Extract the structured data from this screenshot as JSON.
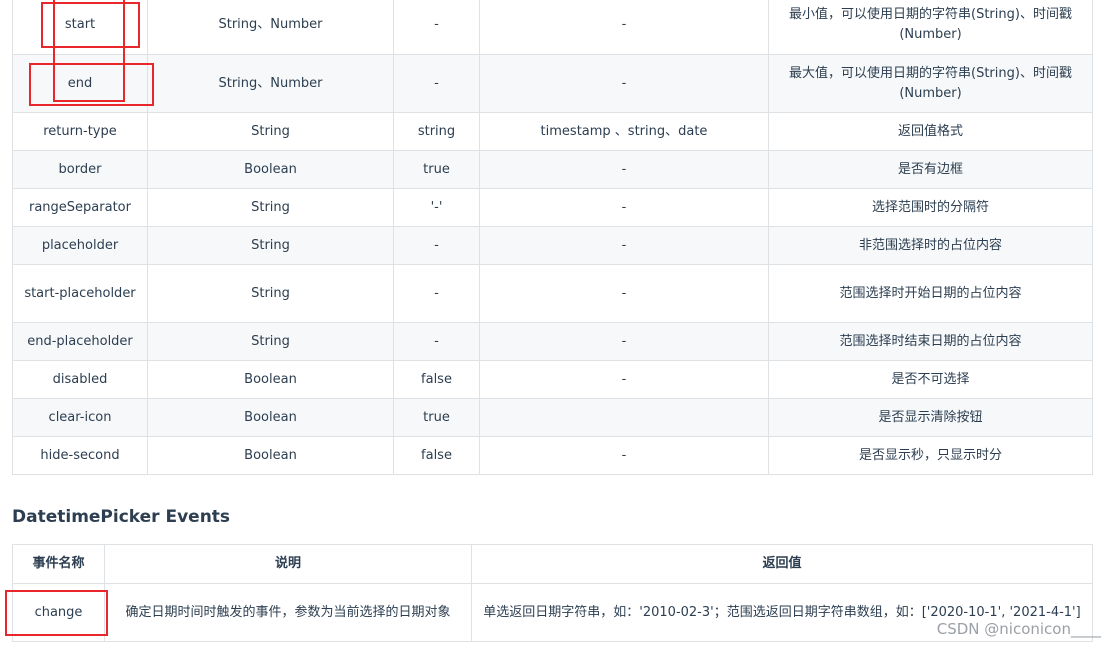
{
  "props_table": {
    "rows": [
      {
        "name": "start",
        "type": "String、Number",
        "default": "-",
        "options": "-",
        "desc": "最小值，可以使用日期的字符串(String)、时间戳(Number)"
      },
      {
        "name": "end",
        "type": "String、Number",
        "default": "-",
        "options": "-",
        "desc": "最大值，可以使用日期的字符串(String)、时间戳(Number)"
      },
      {
        "name": "return-type",
        "type": "String",
        "default": "string",
        "options": "timestamp 、string、date",
        "desc": "返回值格式"
      },
      {
        "name": "border",
        "type": "Boolean",
        "default": "true",
        "options": "-",
        "desc": "是否有边框"
      },
      {
        "name": "rangeSeparator",
        "type": "String",
        "default": "'-'",
        "options": "-",
        "desc": "选择范围时的分隔符"
      },
      {
        "name": "placeholder",
        "type": "String",
        "default": "-",
        "options": "-",
        "desc": "非范围选择时的占位内容"
      },
      {
        "name": "start-placeholder",
        "type": "String",
        "default": "-",
        "options": "-",
        "desc": "范围选择时开始日期的占位内容"
      },
      {
        "name": "end-placeholder",
        "type": "String",
        "default": "-",
        "options": "-",
        "desc": "范围选择时结束日期的占位内容"
      },
      {
        "name": "disabled",
        "type": "Boolean",
        "default": "false",
        "options": "-",
        "desc": "是否不可选择"
      },
      {
        "name": "clear-icon",
        "type": "Boolean",
        "default": "true",
        "options": "",
        "desc": "是否显示清除按钮"
      },
      {
        "name": "hide-second",
        "type": "Boolean",
        "default": "false",
        "options": "-",
        "desc": "是否显示秒，只显示时分"
      }
    ]
  },
  "events_section": {
    "title": "DatetimePicker Events",
    "headers": [
      "事件名称",
      "说明",
      "返回值"
    ],
    "rows": [
      {
        "name": "change",
        "desc": "确定日期时间时触发的事件，参数为当前选择的日期对象",
        "returns": "单选返回日期字符串，如：'2010-02-3'；范围选返回日期字符串数组，如：['2020-10-1', '2021-4-1']"
      }
    ]
  },
  "watermark": "CSDN @niconicon____",
  "colors": {
    "highlight": "#e8262c",
    "border": "#dfe2e5",
    "stripe": "#f6f8fa"
  }
}
